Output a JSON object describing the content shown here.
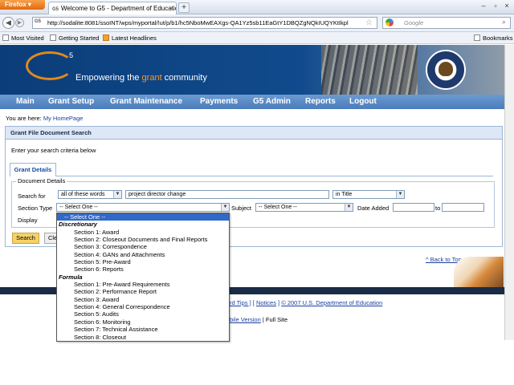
{
  "browser": {
    "firefox_button": "Firefox",
    "tab_title": "Welcome to G5 - Department of Educatio...",
    "tab_favicon": "G5",
    "url": "http://sodalite:8081/ssoINT/wps/myportal/!ut/p/b1/hc5NboMwEAXgs-QA1Yz5sb11EaGtY1DBQZgNQkIUQYKtIkpl",
    "search_placeholder": "Google",
    "bookmarks": [
      "Most Visited",
      "Getting Started",
      "Latest Headlines"
    ],
    "bookmarks_menu": "Bookmarks"
  },
  "banner": {
    "logo": "G",
    "logo_sup": "5",
    "tagline_pre": "Empowering the ",
    "tagline_grant": "grant",
    "tagline_post": " community"
  },
  "nav": [
    "Main",
    "Grant Setup",
    "Grant Maintenance",
    "Payments",
    "G5 Admin",
    "Reports",
    "Logout"
  ],
  "breadcrumb": {
    "prefix": "You are here: ",
    "link": "My HomePage"
  },
  "panel": {
    "title": "Grant File Document Search",
    "instructions": "Enter your search criteria below",
    "tab": "Grant Details",
    "legend": "Document Details"
  },
  "form": {
    "search_for_label": "Search for",
    "match_mode": "all of these words",
    "search_text": "project director change",
    "search_scope": "in Title",
    "section_type_label": "Section Type",
    "section_type_value": "-- Select One --",
    "subject_label": "Subject",
    "subject_value": "-- Select One --",
    "date_added_label": "Date Added",
    "to_label": "to",
    "display_label": "Display",
    "search_button": "Search",
    "clear_button": "Clear"
  },
  "dropdown": [
    {
      "label": "-- Select One --",
      "kind": "selected"
    },
    {
      "label": "Discretionary",
      "kind": "group"
    },
    {
      "label": "Section 1: Award",
      "kind": "option"
    },
    {
      "label": "Section 2: Closeout Documents and Final Reports",
      "kind": "option"
    },
    {
      "label": "Section 3: Correspondence",
      "kind": "option"
    },
    {
      "label": "Section 4: GANs and Attachments",
      "kind": "option"
    },
    {
      "label": "Section 5: Pre-Award",
      "kind": "option"
    },
    {
      "label": "Section 6: Reports",
      "kind": "option"
    },
    {
      "label": "Formula",
      "kind": "group"
    },
    {
      "label": "Section 1: Pre-Award Requirements",
      "kind": "option"
    },
    {
      "label": "Section 2: Performance Report",
      "kind": "option"
    },
    {
      "label": "Section 3: Award",
      "kind": "option"
    },
    {
      "label": "Section 4: General Correspondence",
      "kind": "option"
    },
    {
      "label": "Section 5: Audits",
      "kind": "option"
    },
    {
      "label": "Section 6: Monitoring",
      "kind": "option"
    },
    {
      "label": "Section 7: Technical Assistance",
      "kind": "option"
    },
    {
      "label": "Section 8: Closeout",
      "kind": "option"
    }
  ],
  "footer": {
    "back_to_top": "^ Back to Top",
    "links_a": "rd Tips ]",
    "links_b": " [ ",
    "links_c": "Notices",
    "links_d": " ] ",
    "links_e": "© 2007 U.S. Department of Education",
    "mobile_link": "bile Version",
    "mobile_sep": " | Full Site"
  }
}
